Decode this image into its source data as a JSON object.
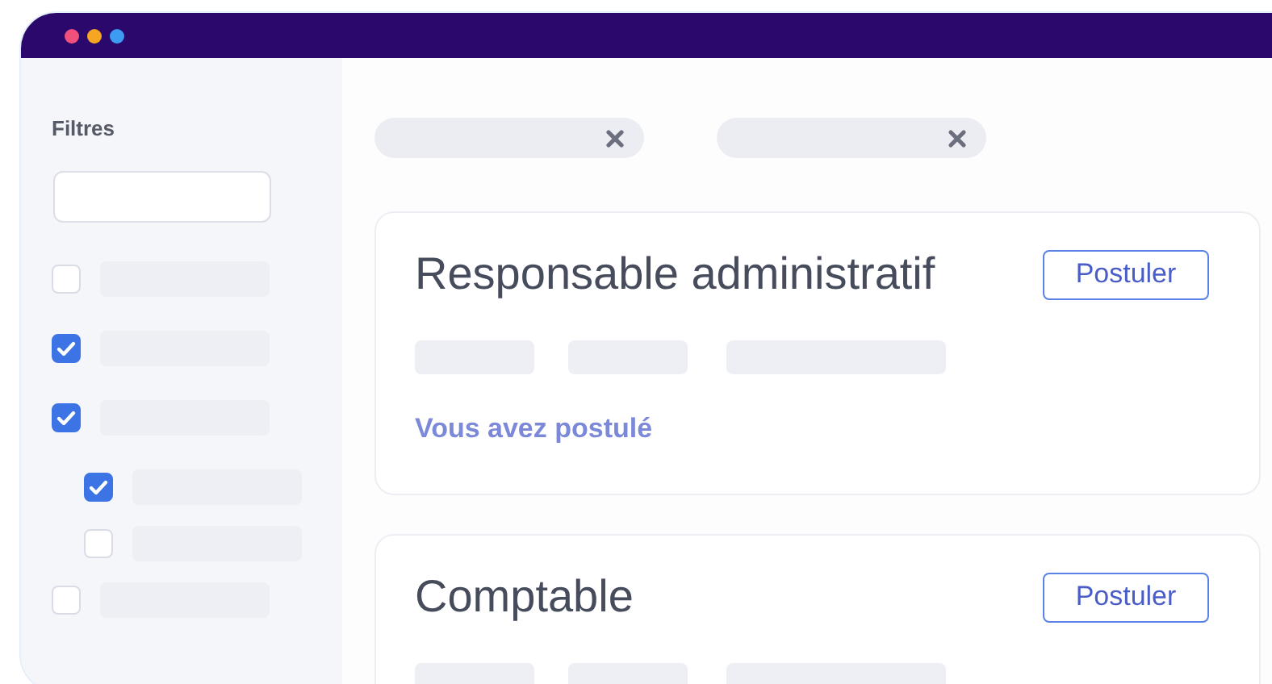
{
  "sidebar": {
    "title": "Filtres",
    "search_field": true,
    "filters": [
      {
        "checked": false
      },
      {
        "checked": true
      },
      {
        "checked": true,
        "children": [
          {
            "checked": true
          },
          {
            "checked": false
          }
        ]
      },
      {
        "checked": false
      }
    ]
  },
  "chips": [
    {
      "removable": true
    },
    {
      "removable": true
    }
  ],
  "jobs": [
    {
      "title": "Responsable administratif",
      "button": "Postuler",
      "note": "Vous avez postulé"
    },
    {
      "title": "Comptable",
      "button": "Postuler"
    }
  ]
}
